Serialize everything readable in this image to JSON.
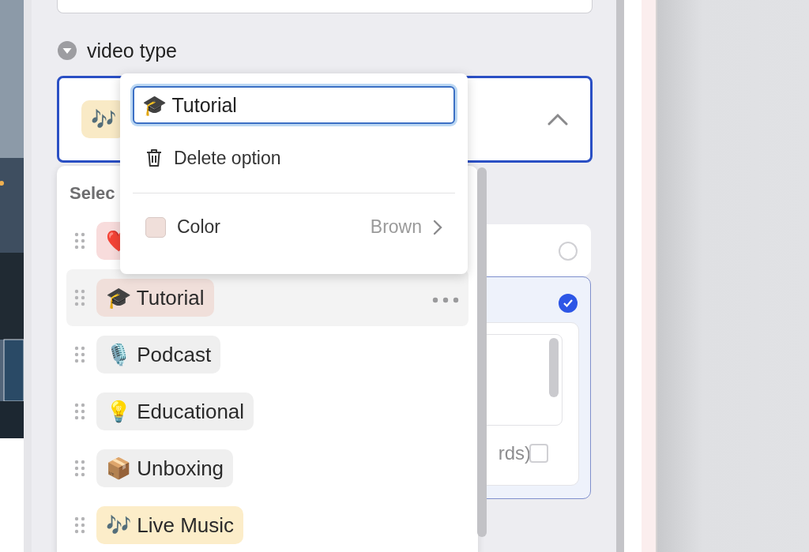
{
  "field_label": "video type",
  "select": {
    "value_emoji": "🎶",
    "expanded": true
  },
  "option_editor": {
    "name_value": "🎓 Tutorial",
    "delete_label": "Delete option",
    "color_label": "Color",
    "color_value": "Brown"
  },
  "options_list": {
    "heading": "Selec",
    "options": [
      {
        "emoji": "❤️",
        "color": "#f8dcdc",
        "selected": false
      },
      {
        "emoji": "🎓",
        "label": "Tutorial",
        "color": "#f0dfda",
        "selected": true
      },
      {
        "emoji": "🎙️",
        "label": "Podcast",
        "color": "#efefef",
        "selected": false
      },
      {
        "emoji": "💡",
        "label": "Educational",
        "color": "#efefef",
        "selected": false
      },
      {
        "emoji": "📦",
        "label": "Unboxing",
        "color": "#efefef",
        "selected": false
      },
      {
        "emoji": "🎶",
        "label": "Live Music",
        "color": "#fcedc9",
        "selected": false
      }
    ]
  },
  "cards": [
    {
      "selected": false
    },
    {
      "selected": true,
      "hint": "rds)",
      "checked": false
    }
  ]
}
